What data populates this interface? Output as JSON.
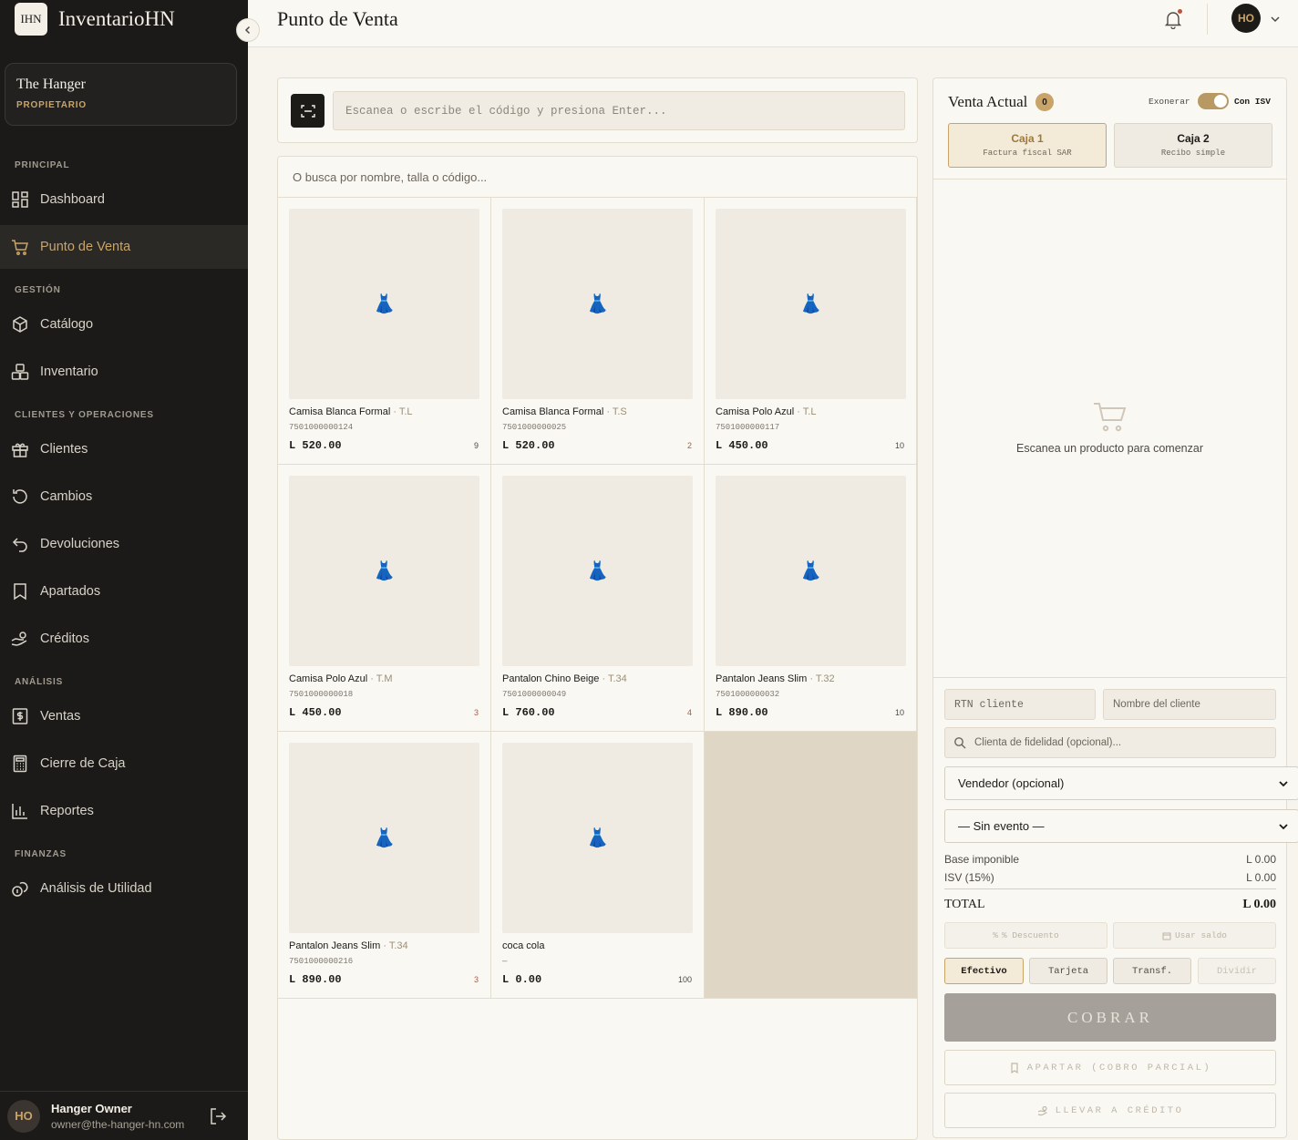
{
  "brand": {
    "logo": "IHN",
    "name": "InventarioHN"
  },
  "store": {
    "name": "The Hanger",
    "role": "PROPIETARIO"
  },
  "nav": {
    "principal": "PRINCIPAL",
    "gestion": "GESTIÓN",
    "clientes_ops": "CLIENTES Y OPERACIONES",
    "analisis": "ANÁLISIS",
    "finanzas": "FINANZAS",
    "items": {
      "dashboard": "Dashboard",
      "pos": "Punto de Venta",
      "catalogo": "Catálogo",
      "inventario": "Inventario",
      "clientes": "Clientes",
      "cambios": "Cambios",
      "devoluciones": "Devoluciones",
      "apartados": "Apartados",
      "creditos": "Créditos",
      "ventas": "Ventas",
      "cierre": "Cierre de Caja",
      "reportes": "Reportes",
      "utilidad": "Análisis de Utilidad"
    }
  },
  "user": {
    "initials": "HO",
    "name": "Hanger Owner",
    "email": "owner@the-hanger-hn.com"
  },
  "header": {
    "title": "Punto de Venta",
    "avatar": "HO"
  },
  "scan": {
    "placeholder": "Escanea o escribe el código y presiona Enter..."
  },
  "search": {
    "placeholder": "O busca por nombre, talla o código..."
  },
  "products": [
    {
      "name": "Camisa Blanca Formal",
      "size": "· T.L",
      "code": "7501000000124",
      "price": "L 520.00",
      "stock": "9",
      "low": false
    },
    {
      "name": "Camisa Blanca Formal",
      "size": "· T.S",
      "code": "7501000000025",
      "price": "L 520.00",
      "stock": "2",
      "low": true
    },
    {
      "name": "Camisa Polo Azul",
      "size": "· T.L",
      "code": "7501000000117",
      "price": "L 450.00",
      "stock": "10",
      "low": false
    },
    {
      "name": "Camisa Polo Azul",
      "size": "· T.M",
      "code": "7501000000018",
      "price": "L 450.00",
      "stock": "3",
      "low": true
    },
    {
      "name": "Pantalon Chino Beige",
      "size": "· T.34",
      "code": "7501000000049",
      "price": "L 760.00",
      "stock": "4",
      "low": true
    },
    {
      "name": "Pantalon Jeans Slim",
      "size": "· T.32",
      "code": "7501000000032",
      "price": "L 890.00",
      "stock": "10",
      "low": false
    },
    {
      "name": "Pantalon Jeans Slim",
      "size": "· T.34",
      "code": "7501000000216",
      "price": "L 890.00",
      "stock": "3",
      "low": true
    },
    {
      "name": "coca cola",
      "size": "",
      "code": "—",
      "price": "L 0.00",
      "stock": "100",
      "low": false
    }
  ],
  "product_icon": "👗",
  "sale": {
    "title": "Venta Actual",
    "count": "0",
    "exonerar": "Exonerar",
    "isv": "Con ISV",
    "cajas": [
      {
        "name": "Caja 1",
        "sub": "Factura fiscal SAR"
      },
      {
        "name": "Caja 2",
        "sub": "Recibo simple"
      }
    ],
    "empty_msg": "Escanea un producto para comenzar",
    "rtn_placeholder": "RTN cliente",
    "nombre_placeholder": "Nombre del cliente",
    "fidelidad_placeholder": "Clienta de fidelidad (opcional)...",
    "vendedor": "Vendedor (opcional)",
    "evento": "— Sin evento —",
    "base_label": "Base imponible",
    "base_value": "L 0.00",
    "isv_label": "ISV (15%)",
    "isv_value": "L 0.00",
    "total_label": "TOTAL",
    "total_value": "L 0.00",
    "descuento": "% Descuento",
    "usar_saldo": "Usar saldo",
    "pay_methods": [
      "Efectivo",
      "Tarjeta",
      "Transf.",
      "Dividir"
    ],
    "cobrar": "COBRAR",
    "apartar": "APARTAR (COBRO PARCIAL)",
    "credito": "LLEVAR A CRÉDITO"
  },
  "colors": {
    "accent": "#c9a468",
    "sidebar": "#1b1a18",
    "background": "#f7f4ee",
    "low_stock": "#b8553a"
  }
}
